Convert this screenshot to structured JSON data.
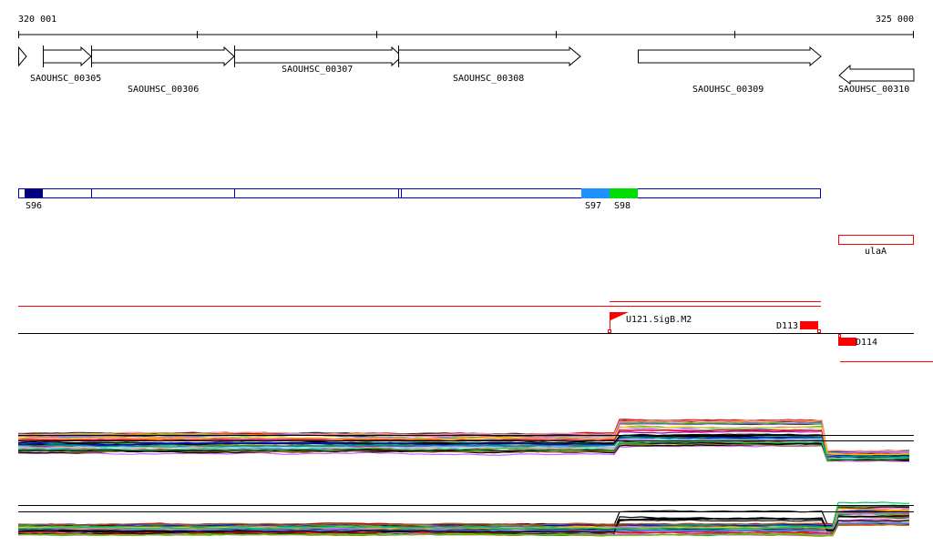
{
  "ruler": {
    "start_label": "320 001",
    "end_label": "325 000"
  },
  "genes": [
    {
      "label": "SAOUHSC_00305",
      "strand": "+"
    },
    {
      "label": "SAOUHSC_00306",
      "strand": "+"
    },
    {
      "label": "SAOUHSC_00307",
      "strand": "+"
    },
    {
      "label": "SAOUHSC_00308",
      "strand": "+"
    },
    {
      "label": "SAOUHSC_00309",
      "strand": "+"
    },
    {
      "label": "SAOUHSC_00310",
      "strand": "-"
    }
  ],
  "segments": [
    {
      "label": "S96",
      "color": "#000080"
    },
    {
      "label": "S97",
      "color": "#1e90ff"
    },
    {
      "label": "S98",
      "color": "#00dd00"
    }
  ],
  "feature_box": {
    "label": "ulaA",
    "color": "#ff0000"
  },
  "sites": [
    {
      "label": "U121.SigB.M2"
    },
    {
      "label": "D113"
    },
    {
      "label": "D114"
    }
  ],
  "colors": {
    "accent": "#ff0000",
    "segment_outline": "#0000cc"
  },
  "profile_colors": [
    "#ff0000",
    "#00aa00",
    "#0000ff",
    "#ff8800",
    "#aa00aa",
    "#00aaaa",
    "#888800",
    "#884400",
    "#ff66cc",
    "#66cc00",
    "#6666ff",
    "#cc0000",
    "#009966",
    "#996633",
    "#333333",
    "#ff9999",
    "#99ccff",
    "#cc66ff",
    "#ffcc00",
    "#00cc66"
  ]
}
